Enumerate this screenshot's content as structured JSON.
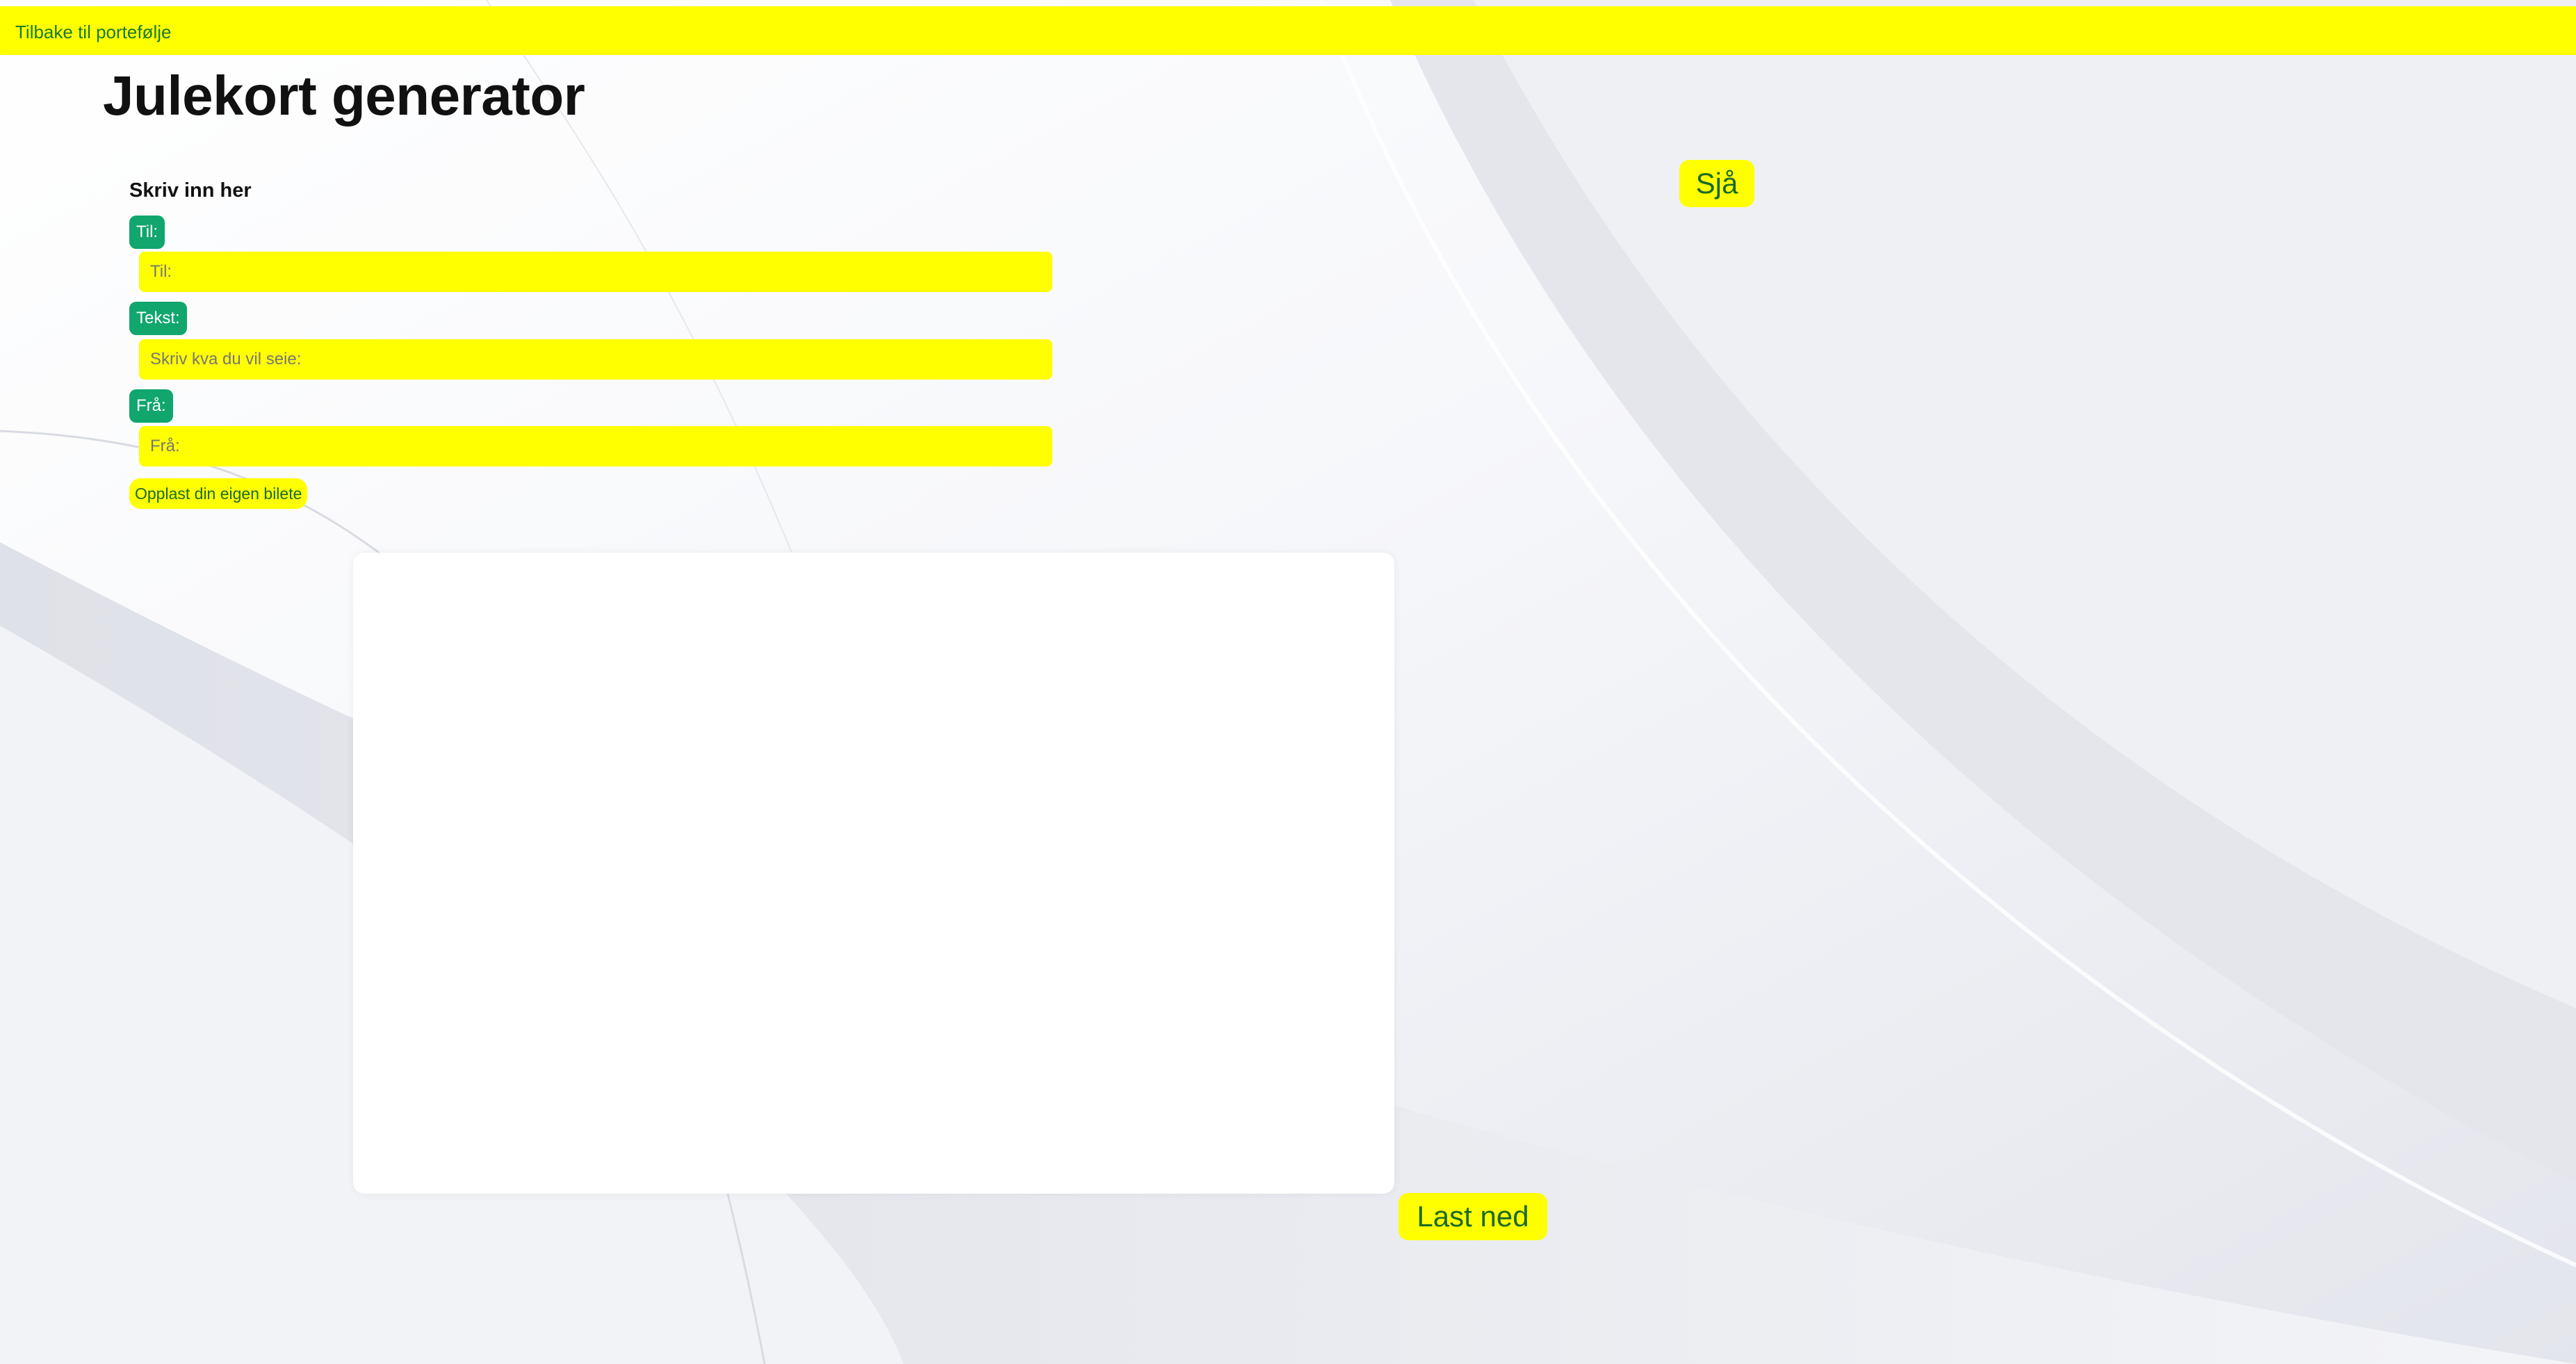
{
  "nav": {
    "back_label": "Tilbake til portefølje"
  },
  "page": {
    "title": "Julekort generator"
  },
  "form": {
    "heading": "Skriv inn her",
    "to_label": "Til:",
    "to_placeholder": "Til:",
    "text_label": "Tekst:",
    "text_placeholder": "Skriv kva du vil seie:",
    "from_label": "Frå:",
    "from_placeholder": "Frå:",
    "upload_label": "Opplast din eigen bilete"
  },
  "actions": {
    "see_label": "Sjå",
    "download_label": "Last ned"
  },
  "colors": {
    "accent_yellow": "#ffff00",
    "label_green": "#10a66e",
    "link_green": "#1a6a2a",
    "background": "#eceef3"
  }
}
